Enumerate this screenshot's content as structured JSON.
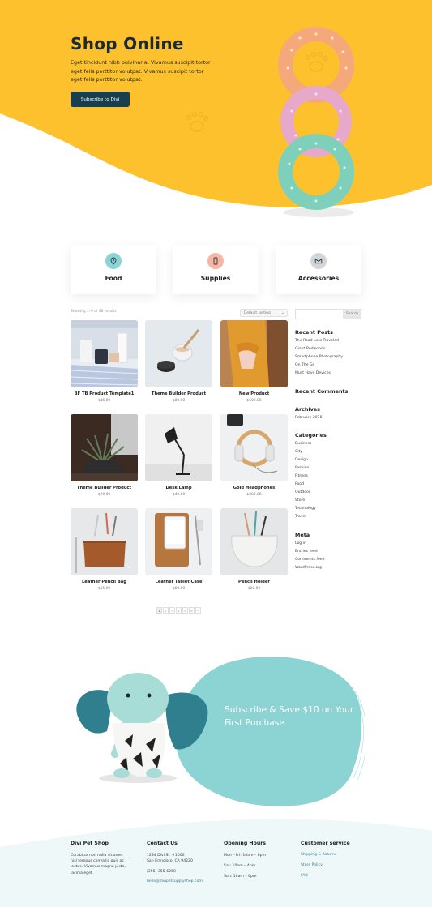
{
  "colors": {
    "hero_yellow": "#fcc12c",
    "button": "#173f4f",
    "teal": "#8cd3d4",
    "footer_tint": "#eef8f8"
  },
  "hero": {
    "title": "Shop Online",
    "text": "Eget tincidunt nibh pulvinar a. Vivamus suscipit tortor eget felis porttitor volutpat. Vivamus suscipit tortor eget felis porttitor volutpat.",
    "button_label": "Subscribe to Divi"
  },
  "categories": [
    {
      "label": "Food",
      "icon": "map-pin-icon",
      "color": "#8cd3d4"
    },
    {
      "label": "Supplies",
      "icon": "phone-icon",
      "color": "#f7b6a3"
    },
    {
      "label": "Accessories",
      "icon": "envelope-icon",
      "color": "#d5d5d5"
    }
  ],
  "shop": {
    "result_count": "Showing 1–9 of 48 results",
    "sort_label": "Default sorting",
    "products": [
      {
        "name": "BF TB Product Template1",
        "price": "$46.00"
      },
      {
        "name": "Theme Builder Product",
        "price": "$89.00"
      },
      {
        "name": "New Product",
        "price": "$500.00"
      },
      {
        "name": "Theme Builder Product",
        "price": "$20.00"
      },
      {
        "name": "Desk Lamp",
        "price": "$40.00"
      },
      {
        "name": "Gold Headphones",
        "price": "$200.00"
      },
      {
        "name": "Leather Pencil Bag",
        "price": "$15.00"
      },
      {
        "name": "Leather Tablet Case",
        "price": "$60.00"
      },
      {
        "name": "Pencil Holder",
        "price": "$20.00"
      }
    ],
    "pages": [
      "1",
      "2",
      "3",
      "4",
      "5",
      "6",
      "→"
    ]
  },
  "sidebar": {
    "search_button": "Search",
    "recent_posts_title": "Recent Posts",
    "recent_posts": [
      "The Road Less Traveled",
      "Giant Redwoods",
      "Smartphone Photography",
      "On The Go",
      "Must Have Devices"
    ],
    "recent_comments_title": "Recent Comments",
    "archives_title": "Archives",
    "archives": [
      "February 2018"
    ],
    "categories_title": "Categories",
    "categories": [
      "Business",
      "City",
      "Design",
      "Fashion",
      "Fitness",
      "Food",
      "Outdoor",
      "Store",
      "Technology",
      "Travel"
    ],
    "meta_title": "Meta",
    "meta": [
      "Log in",
      "Entries feed",
      "Comments feed",
      "WordPress.org"
    ]
  },
  "subscribe": {
    "text": "Subscribe & Save $10 on Your First Purchase"
  },
  "footer": {
    "col1": {
      "title": "Divi Pet Shop",
      "text": "Curabitur non nulla sit amet nisl tempus convallis quis ac lectus. Vivamus magna justo, lacinia eget."
    },
    "col2": {
      "title": "Contact Us",
      "address1": "1234 Divi St. #1000",
      "address2": "San Francisco, CA 94220",
      "phone": "(355) 355-6258",
      "email": "hello@divipetsupplyshop.com"
    },
    "col3": {
      "title": "Opening Hours",
      "hours": [
        "Mon – Fri: 10am – 8pm",
        "Sat: 10am – 4pm",
        "Sun: 10am – 6pm"
      ]
    },
    "col4": {
      "title": "Customer service",
      "links": [
        "Shipping & Returns",
        "Store Policy",
        "FAQ"
      ]
    }
  }
}
